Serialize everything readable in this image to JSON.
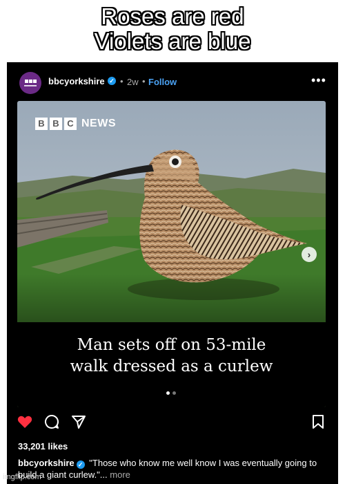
{
  "meme": {
    "caption_line1": "Roses are red",
    "caption_line2": "Violets are blue"
  },
  "post": {
    "username": "bbcyorkshire",
    "time_ago": "2w",
    "follow_label": "Follow",
    "media": {
      "logo_letters": [
        "B",
        "B",
        "C"
      ],
      "logo_word": "NEWS",
      "headline_line1": "Man sets off on 53-mile",
      "headline_line2": "walk dressed as a curlew",
      "carousel_index": 1,
      "carousel_total": 2
    },
    "likes": "33,201 likes",
    "caption_user": "bbcyorkshire",
    "caption_text": "\"Those who know me well know I was eventually going to build a giant curlew.\"...",
    "more_label": "more",
    "liked": true
  },
  "watermark": "imgflip.com",
  "colors": {
    "like_red": "#ff3040",
    "follow_blue": "#4ba3f5",
    "avatar_purple": "#6b2a86",
    "verified_blue": "#1d9bf0"
  }
}
